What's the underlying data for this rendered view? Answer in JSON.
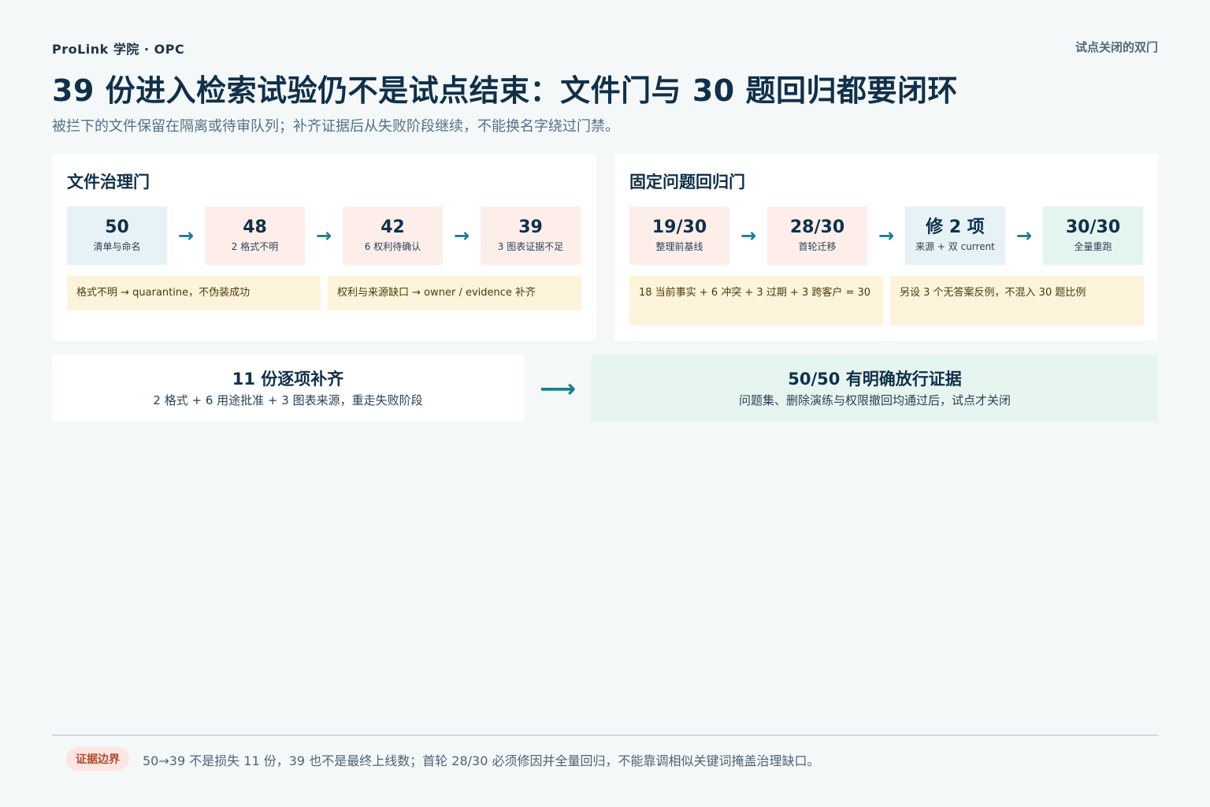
{
  "header": {
    "brand": "ProLink 学院 · OPC",
    "kicker": "试点关闭的双门",
    "title": "39 份进入检索试验仍不是试点结束：文件门与 30 题回归都要闭环",
    "subtitle": "被拦下的文件保留在隔离或待审队列；补齐证据后从失败阶段继续，不能换名字绕过门禁。"
  },
  "file_gate": {
    "title": "文件治理门",
    "steps": [
      {
        "value": "50",
        "label": "清单与命名"
      },
      {
        "value": "48",
        "label": "2 格式不明"
      },
      {
        "value": "42",
        "label": "6 权利待确认"
      },
      {
        "value": "39",
        "label": "3 图表证据不足"
      }
    ],
    "notes": [
      "格式不明 → quarantine，不伪装成功",
      "权利与来源缺口 → owner / evidence 补齐"
    ]
  },
  "regression_gate": {
    "title": "固定问题回归门",
    "steps": [
      {
        "value": "19/30",
        "label": "整理前基线"
      },
      {
        "value": "28/30",
        "label": "首轮迁移"
      },
      {
        "value": "修 2 项",
        "label": "来源 + 双 current"
      },
      {
        "value": "30/30",
        "label": "全量重跑"
      }
    ],
    "notes": [
      "18 当前事实 + 6 冲突 + 3 过期 + 3 跨客户 = 30",
      "另设 3 个无答案反例，不混入 30 题比例"
    ]
  },
  "flow": {
    "left_title": "11 份逐项补齐",
    "left_sub": "2 格式 + 6 用途批准 + 3 图表来源，重走失败阶段",
    "arrow": "⟶",
    "right_title": "50/50 有明确放行证据",
    "right_sub": "问题集、删除演练与权限撤回均通过后，试点才关闭"
  },
  "footer": {
    "badge": "证据边界",
    "text": "50→39 不是损失 11 份，39 也不是最终上线数；首轮 28/30 必须修因并全量回归，不能靠调相似关键词掩盖治理缺口。"
  },
  "arrow_glyph": "→"
}
